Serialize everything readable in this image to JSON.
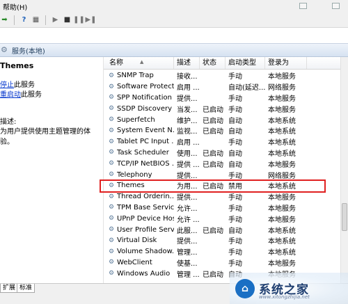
{
  "menubar": {
    "items": [
      "帮助(H)"
    ]
  },
  "window_controls": [
    "minimize",
    "close"
  ],
  "toolbar": {
    "icons": [
      "back-icon",
      "help-icon",
      "properties-icon",
      "play-icon",
      "stop-icon",
      "pause-icon",
      "restart-icon"
    ]
  },
  "header": {
    "title": "服务(本地)"
  },
  "left_pane": {
    "service_name": "Themes",
    "stop_link": "停止",
    "stop_suffix": "此服务",
    "restart_link": "重启动",
    "restart_suffix": "此服务",
    "description_label": "描述:",
    "description_text": "为用户提供使用主题管理的体验。"
  },
  "columns": [
    "名称",
    "描述",
    "状态",
    "启动类型",
    "登录为"
  ],
  "rows": [
    {
      "name": "SNMP Trap",
      "desc": "接收...",
      "status": "",
      "startup": "手动",
      "logon": "本地服务"
    },
    {
      "name": "Software Protect...",
      "desc": "启用 ...",
      "status": "",
      "startup": "自动(延迟...",
      "logon": "网络服务"
    },
    {
      "name": "SPP Notification ...",
      "desc": "提供...",
      "status": "",
      "startup": "手动",
      "logon": "本地服务"
    },
    {
      "name": "SSDP Discovery",
      "desc": "当发...",
      "status": "已启动",
      "startup": "手动",
      "logon": "本地服务"
    },
    {
      "name": "Superfetch",
      "desc": "维护...",
      "status": "已启动",
      "startup": "自动",
      "logon": "本地系统"
    },
    {
      "name": "System Event N...",
      "desc": "监视...",
      "status": "已启动",
      "startup": "自动",
      "logon": "本地系统"
    },
    {
      "name": "Tablet PC Input ...",
      "desc": "启用 ...",
      "status": "",
      "startup": "手动",
      "logon": "本地系统"
    },
    {
      "name": "Task Scheduler",
      "desc": "使用...",
      "status": "已启动",
      "startup": "自动",
      "logon": "本地系统"
    },
    {
      "name": "TCP/IP NetBIOS ...",
      "desc": "提供 ...",
      "status": "已启动",
      "startup": "自动",
      "logon": "本地服务"
    },
    {
      "name": "Telephony",
      "desc": "提供...",
      "status": "",
      "startup": "手动",
      "logon": "网络服务"
    },
    {
      "name": "Themes",
      "desc": "为用...",
      "status": "已启动",
      "startup": "禁用",
      "logon": "本地系统"
    },
    {
      "name": "Thread Orderin...",
      "desc": "提供...",
      "status": "",
      "startup": "手动",
      "logon": "本地服务"
    },
    {
      "name": "TPM Base Servic...",
      "desc": "允许...",
      "status": "",
      "startup": "手动",
      "logon": "本地服务"
    },
    {
      "name": "UPnP Device Host",
      "desc": "允许 ...",
      "status": "",
      "startup": "手动",
      "logon": "本地服务"
    },
    {
      "name": "User Profile Serv...",
      "desc": "此服...",
      "status": "已启动",
      "startup": "自动",
      "logon": "本地系统"
    },
    {
      "name": "Virtual Disk",
      "desc": "提供...",
      "status": "",
      "startup": "手动",
      "logon": "本地系统"
    },
    {
      "name": "Volume Shadow...",
      "desc": "管理...",
      "status": "",
      "startup": "手动",
      "logon": "本地系统"
    },
    {
      "name": "WebClient",
      "desc": "使基...",
      "status": "",
      "startup": "手动",
      "logon": "本地服务"
    },
    {
      "name": "Windows Audio",
      "desc": "管理 ...",
      "status": "已启动",
      "startup": "自动",
      "logon": "本地服务"
    }
  ],
  "highlighted_row": "Themes",
  "bottom_tabs": [
    "扩展",
    "标准"
  ],
  "watermark": {
    "text": "系统之家",
    "subtext": "www.xitongzhijia.net"
  },
  "colors": {
    "highlight_border": "#e02020",
    "link": "#0033cc",
    "header_bg": "#d6e2f1"
  }
}
